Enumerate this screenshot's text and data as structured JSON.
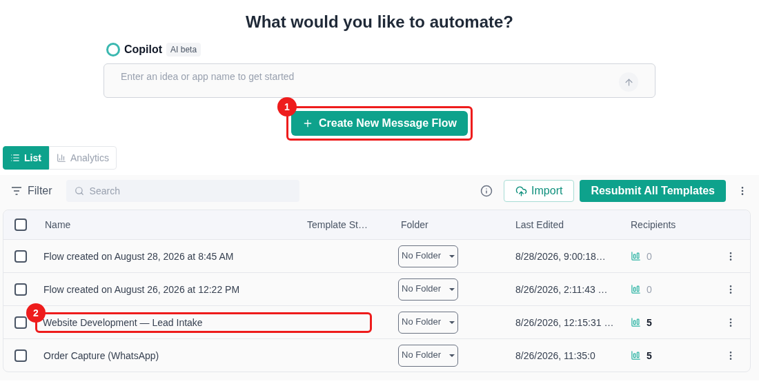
{
  "heading": "What would you like to automate?",
  "copilot": {
    "name": "Copilot",
    "badge": "AI beta",
    "placeholder": "Enter an idea or app name to get started"
  },
  "create_button": {
    "label": "Create New Message Flow",
    "marker": "1"
  },
  "view_tabs": [
    {
      "label": "List",
      "selected": true
    },
    {
      "label": "Analytics",
      "selected": false
    }
  ],
  "toolbar": {
    "filter": "Filter",
    "search_placeholder": "Search",
    "import": "Import",
    "resubmit": "Resubmit All Templates"
  },
  "table": {
    "select_all_checked": false,
    "columns": [
      "Name",
      "Template St…",
      "Folder",
      "Last Edited",
      "Recipients"
    ],
    "rows": [
      {
        "checked": false,
        "name": "Flow created on August 28, 2026 at 8:45 AM",
        "folder": "No Folder",
        "last_edited": "8/28/2026, 9:00:18…",
        "recipients": "0",
        "muted": true,
        "marker": ""
      },
      {
        "checked": false,
        "name": "Flow created on August 26, 2026 at 12:22 PM",
        "folder": "No Folder",
        "last_edited": "8/26/2026, 2:11:43 …",
        "recipients": "0",
        "muted": true,
        "marker": ""
      },
      {
        "checked": false,
        "name": "Website Development — Lead Intake",
        "folder": "No Folder",
        "last_edited": "8/26/2026, 12:15:31 …",
        "recipients": "5",
        "muted": false,
        "marker": "2"
      },
      {
        "checked": false,
        "name": "Order Capture (WhatsApp)",
        "folder": "No Folder",
        "last_edited": "8/26/2026, 11:35:0",
        "recipients": "5",
        "muted": false,
        "marker": ""
      }
    ]
  }
}
